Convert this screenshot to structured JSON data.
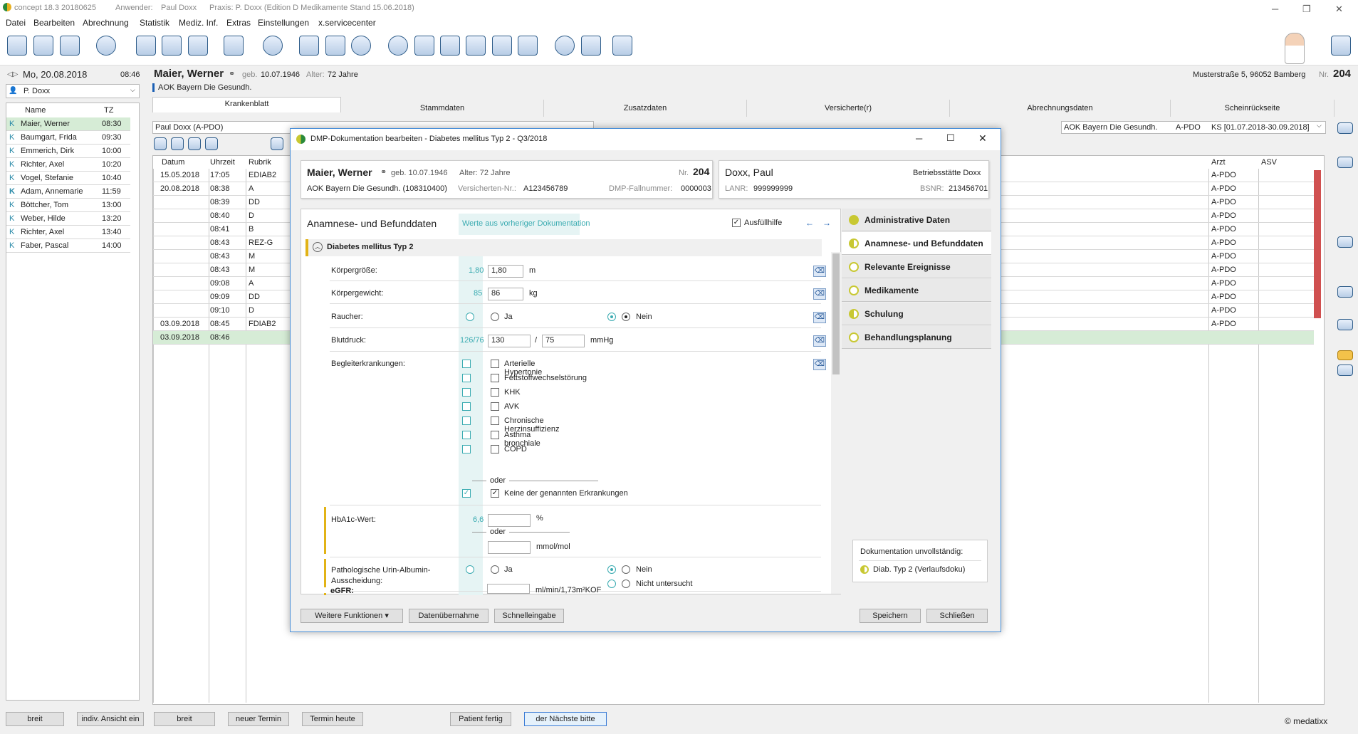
{
  "app": {
    "title": "concept 18.3 20180625",
    "user_label": "Anwender:",
    "user": "Paul Doxx",
    "practice": "Praxis: P. Doxx  (Edition D Medikamente  Stand 15.06.2018)"
  },
  "menu": [
    "Datei",
    "Bearbeiten",
    "Abrechnung",
    "Statistik",
    "Mediz. Inf.",
    "Extras",
    "Einstellungen",
    "x.servicecenter"
  ],
  "left": {
    "date": "Mo, 20.08.2018",
    "time": "08:46",
    "doctor": "P. Doxx",
    "col_name": "Name",
    "col_tz": "TZ",
    "patients": [
      {
        "k": "K",
        "name": "Maier, Werner",
        "tz": "08:30"
      },
      {
        "k": "K",
        "name": "Baumgart, Frida",
        "tz": "09:30"
      },
      {
        "k": "K",
        "name": "Emmerich, Dirk",
        "tz": "10:00"
      },
      {
        "k": "K",
        "name": "Richter, Axel",
        "tz": "10:20"
      },
      {
        "k": "K",
        "name": "Vogel, Stefanie",
        "tz": "10:40"
      },
      {
        "k": "K",
        "name": "Adam, Annemarie",
        "tz": "11:59"
      },
      {
        "k": "K",
        "name": "Böttcher, Tom",
        "tz": "13:00"
      },
      {
        "k": "K",
        "name": "Weber, Hilde",
        "tz": "13:20"
      },
      {
        "k": "K",
        "name": "Richter, Axel",
        "tz": "13:40"
      },
      {
        "k": "K",
        "name": "Faber, Pascal",
        "tz": "14:00"
      }
    ],
    "btn_breit": "breit",
    "btn_indiv": "indiv. Ansicht ein"
  },
  "patient": {
    "name": "Maier, Werner",
    "geb_label": "geb.",
    "geb": "10.07.1946",
    "alter_label": "Alter:",
    "alter": "72 Jahre",
    "insurance": "AOK Bayern Die Gesundh.",
    "address": "Musterstraße 5, 96052 Bamberg",
    "nr_label": "Nr.",
    "nr": "204"
  },
  "tabs": [
    "Krankenblatt",
    "Stammdaten",
    "Zusatzdaten",
    "Versicherte(r)",
    "Abrechnungsdaten",
    "Scheinrückseite"
  ],
  "record": {
    "filter": "Paul Doxx (A-PDO)",
    "schein": "AOK Bayern Die Gesundh.",
    "schein_code": "A-PDO",
    "schein_period": "KS  [01.07.2018-30.09.2018]",
    "cols": {
      "datum": "Datum",
      "uhrzeit": "Uhrzeit",
      "rubrik": "Rubrik",
      "arzt": "Arzt",
      "asv": "ASV"
    },
    "rows": [
      {
        "d": "15.05.2018",
        "t": "17:05",
        "r": "EDIAB2",
        "a": "A-PDO"
      },
      {
        "d": "20.08.2018",
        "t": "08:38",
        "r": "A",
        "a": "A-PDO"
      },
      {
        "d": "",
        "t": "08:39",
        "r": "DD",
        "a": "A-PDO"
      },
      {
        "d": "",
        "t": "08:40",
        "r": "D",
        "a": "A-PDO"
      },
      {
        "d": "",
        "t": "08:41",
        "r": "B",
        "a": "A-PDO"
      },
      {
        "d": "",
        "t": "08:43",
        "r": "REZ-G",
        "a": "A-PDO"
      },
      {
        "d": "",
        "t": "08:43",
        "r": "M",
        "a": "A-PDO"
      },
      {
        "d": "",
        "t": "08:43",
        "r": "M",
        "a": "A-PDO"
      },
      {
        "d": "",
        "t": "09:08",
        "r": "A",
        "a": "A-PDO"
      },
      {
        "d": "",
        "t": "09:09",
        "r": "DD",
        "a": "A-PDO"
      },
      {
        "d": "",
        "t": "09:10",
        "r": "D",
        "a": "A-PDO"
      },
      {
        "d": "03.09.2018",
        "t": "08:45",
        "r": "FDIAB2",
        "a": "A-PDO"
      },
      {
        "d": "03.09.2018",
        "t": "08:46",
        "r": "",
        "a": ""
      }
    ]
  },
  "bottom": {
    "breit": "breit",
    "neuer_termin": "neuer Termin",
    "termin_heute": "Termin heute",
    "patient_fertig": "Patient fertig",
    "naechste": "der Nächste bitte",
    "copyright": "© medatixx"
  },
  "dialog": {
    "title": "DMP-Dokumentation bearbeiten - Diabetes mellitus Typ 2 - Q3/2018",
    "pat_name": "Maier, Werner",
    "pat_geb": "geb. 10.07.1946",
    "pat_alter": "Alter: 72 Jahre",
    "pat_nr_label": "Nr.",
    "pat_nr": "204",
    "pat_kasse": "AOK Bayern Die Gesundh. (108310400)",
    "vers_label": "Versicherten-Nr.:",
    "vers_nr": "A123456789",
    "fall_label": "DMP-Fallnummer:",
    "fall_nr": "0000003",
    "doc_name": "Doxx, Paul",
    "betrieb": "Betriebsstätte Doxx",
    "lanr_label": "LANR:",
    "lanr": "999999999",
    "bsnr_label": "BSNR:",
    "bsnr": "213456701",
    "section": "Anamnese- und Befunddaten",
    "prev_values": "Werte aus vorheriger Dokumentation",
    "ausfuellhilfe": "Ausfüllhilfe",
    "group": "Diabetes mellitus Typ 2",
    "koerpergroesse_label": "Körpergröße:",
    "koerpergroesse_prev": "1,80",
    "koerpergroesse": "1,80",
    "koerpergroesse_unit": "m",
    "gewicht_label": "Körpergewicht:",
    "gewicht_prev": "85",
    "gewicht": "86",
    "gewicht_unit": "kg",
    "raucher_label": "Raucher:",
    "ja": "Ja",
    "nein": "Nein",
    "blutdruck_label": "Blutdruck:",
    "blutdruck_prev": "126/76",
    "bd_sys": "130",
    "bd_slash": "/",
    "bd_dia": "75",
    "bd_unit": "mmHg",
    "begleit_label": "Begleiterkrankungen:",
    "begleit": [
      "Arterielle Hypertonie",
      "Fettstoffwechselstörung",
      "KHK",
      "AVK",
      "Chronische Herzinsuffizienz",
      "Asthma bronchiale",
      "COPD"
    ],
    "oder": "oder",
    "keine": "Keine der genannten Erkrankungen",
    "hba1c_label": "HbA1c-Wert:",
    "hba1c_prev": "6,6",
    "hba1c_unit1": "%",
    "hba1c_unit2": "mmol/mol",
    "urin_label": "Pathologische Urin-Albumin-Ausscheidung:",
    "nicht_untersucht": "Nicht untersucht",
    "egfr_label": "eGFR:",
    "egfr_unit": "ml/min/1,73m²KOF",
    "nav": [
      "Administrative Daten",
      "Anamnese- und Befunddaten",
      "Relevante Ereignisse",
      "Medikamente",
      "Schulung",
      "Behandlungsplanung"
    ],
    "status_title": "Dokumentation unvollständig:",
    "status_item": "Diab. Typ 2 (Verlaufsdoku)",
    "btn_weitere": "Weitere Funktionen",
    "btn_daten": "Datenübernahme",
    "btn_schnell": "Schnelleingabe",
    "btn_speichern": "Speichern",
    "btn_schliessen": "Schließen"
  }
}
